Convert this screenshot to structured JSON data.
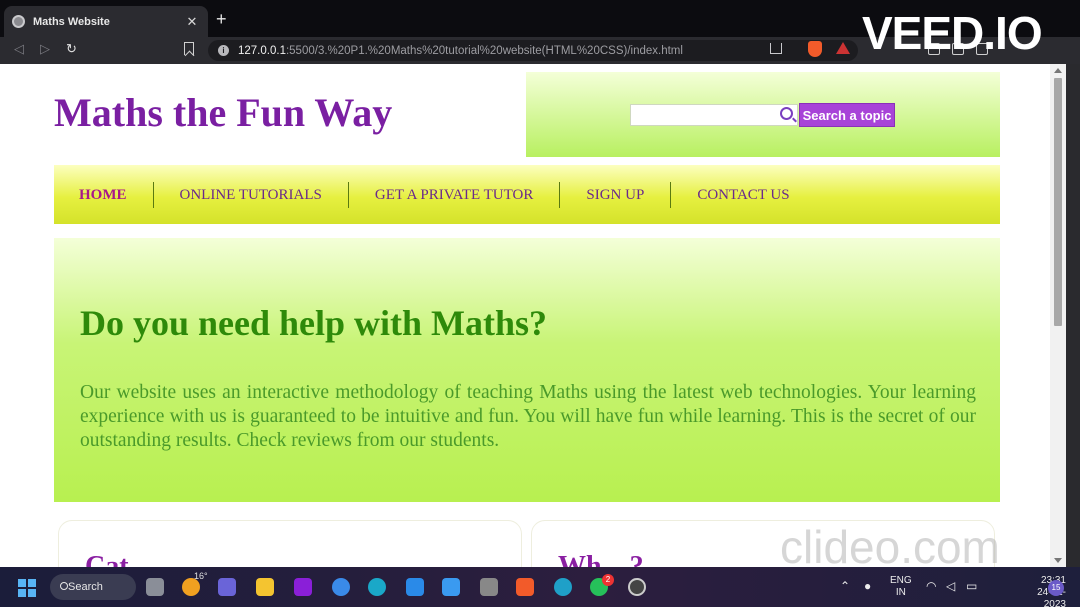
{
  "browser": {
    "tab_title": "Maths Website",
    "tab_close": "✕",
    "new_tab": "+",
    "url_host": "127.0.0.1",
    "url_path": ":5500/3.%20P1.%20Maths%20tutorial%20website(HTML%20CSS)/index.html",
    "back": "◁",
    "forward": "▷",
    "reload": "↻"
  },
  "site": {
    "title": "Maths the Fun Way",
    "search_placeholder": "",
    "search_button": "Search a topic",
    "nav": [
      {
        "label": "HOME"
      },
      {
        "label": "ONLINE TUTORIALS"
      },
      {
        "label": "GET A PRIVATE TUTOR"
      },
      {
        "label": "SIGN UP"
      },
      {
        "label": "CONTACT US"
      }
    ],
    "hero_title": "Do you need help with Maths?",
    "hero_text": "Our website uses an interactive methodology of teaching Maths using the latest web technologies. Your learning experience with us is guaranteed to be intuitive and fun. You will have fun while learning. This is the secret of our outstanding results. Check reviews from our students.",
    "card1_title": "Cat...",
    "card2_title": "Wh... ?"
  },
  "watermarks": {
    "top": "VEED.IO",
    "bottom": "clideo.com"
  },
  "taskbar": {
    "search_label": "Search",
    "weather": "16°",
    "whatsapp_badge": "2",
    "lang_line1": "ENG",
    "lang_line2": "IN",
    "time": "23:31",
    "date": "24-01-2023",
    "notifications": "15"
  },
  "colors": {
    "title_purple": "#7a1fa2",
    "hero_green": "#2e8a0a",
    "search_button": "#a843d8"
  }
}
